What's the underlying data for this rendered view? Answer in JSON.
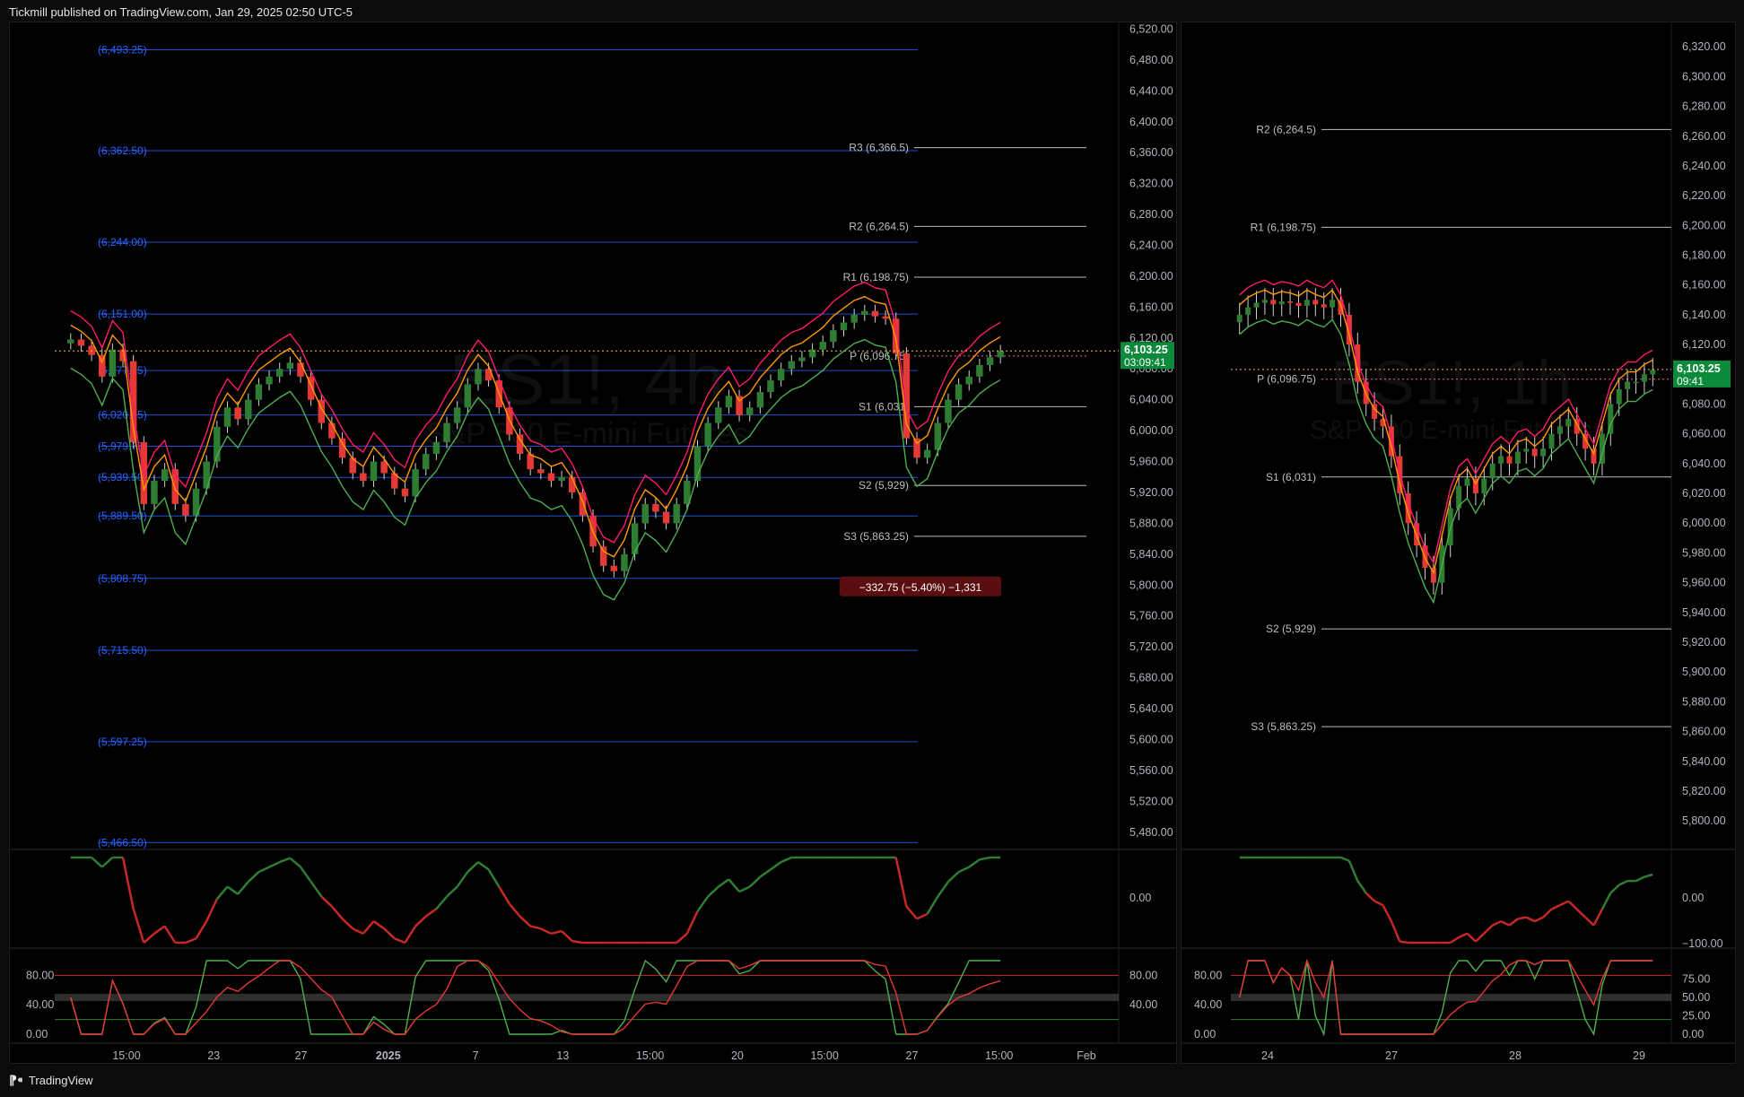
{
  "header": {
    "publisher": "Tickmill published on TradingView.com, Jan 29, 2025 02:50 UTC-5"
  },
  "footer": {
    "brand": "TradingView",
    "logo_icon": "tradingview-logo-icon"
  },
  "colors": {
    "up": "#2e7d32",
    "down": "#e53935",
    "pivot": "#bdbdbd",
    "fib": "#2962ff",
    "magenta": "#ff1a6b",
    "orange": "#ff9800",
    "green": "#4caf50",
    "price_badge": "#0a8a3a"
  },
  "chart_data": [
    {
      "type": "candlestick",
      "watermark": {
        "symbol": "ES1!, 4h",
        "name": "S&P 500 E-mini Futures"
      },
      "x_tick_labels": [
        "15:00",
        "23",
        "27",
        "2025",
        "7",
        "13",
        "15:00",
        "20",
        "15:00",
        "27",
        "15:00",
        "Feb"
      ],
      "y_tick_labels": [
        "6,520.00",
        "6,480.00",
        "6,440.00",
        "6,400.00",
        "6,360.00",
        "6,320.00",
        "6,280.00",
        "6,240.00",
        "6,200.00",
        "6,160.00",
        "6,120.00",
        "6,080.00",
        "6,040.00",
        "6,000.00",
        "5,960.00",
        "5,920.00",
        "5,880.00",
        "5,840.00",
        "5,800.00",
        "5,760.00",
        "5,720.00",
        "5,680.00",
        "5,640.00",
        "5,600.00",
        "5,560.00",
        "5,520.00",
        "5,480.00"
      ],
      "ylim": [
        5460,
        6524
      ],
      "fib_levels": [
        {
          "label": "(6,493.25)",
          "value": 6493.25
        },
        {
          "label": "(6,362.50)",
          "value": 6362.5
        },
        {
          "label": "(6,244.00)",
          "value": 6244
        },
        {
          "label": "(6,151.00)",
          "value": 6151
        },
        {
          "label": "(6,077.75)",
          "value": 6077.75
        },
        {
          "label": "(6,020.25)",
          "value": 6020.25
        },
        {
          "label": "(5,979.75)",
          "value": 5979.75
        },
        {
          "label": "(5,939.50)",
          "value": 5939.5
        },
        {
          "label": "(5,889.50)",
          "value": 5889.5
        },
        {
          "label": "(5,808.75)",
          "value": 5808.75
        },
        {
          "label": "(5,715.50)",
          "value": 5715.5
        },
        {
          "label": "(5,597.25)",
          "value": 5597.25
        },
        {
          "label": "(5,466.50)",
          "value": 5466.5
        }
      ],
      "pivots": [
        {
          "label": "R3 (6,366.5)",
          "value": 6366.5
        },
        {
          "label": "R2 (6,264.5)",
          "value": 6264.5
        },
        {
          "label": "R1 (6,198.75)",
          "value": 6198.75
        },
        {
          "label": "P (6,096.75)",
          "value": 6096.75
        },
        {
          "label": "S1 (6,031)",
          "value": 6031
        },
        {
          "label": "S2 (5,929)",
          "value": 5929
        },
        {
          "label": "S3 (5,863.25)",
          "value": 5863.25
        }
      ],
      "last_price": "6,103.25",
      "countdown": "03:09:41",
      "measure_label": "−332.75 (−5.40%) −1,331",
      "oscillator": {
        "y_tick_labels": [
          "0.00"
        ]
      },
      "stochastic": {
        "y_tick_labels": [
          "80.00",
          "40.00",
          "0.00"
        ],
        "right_labels": [
          "80.00",
          "40.00"
        ]
      },
      "close": [
        6118,
        6110,
        6098,
        6070,
        6105,
        6090,
        5985,
        5905,
        5935,
        5950,
        5905,
        5890,
        5925,
        5960,
        6005,
        6030,
        6015,
        6040,
        6060,
        6070,
        6080,
        6088,
        6070,
        6040,
        6010,
        5990,
        5965,
        5945,
        5935,
        5960,
        5945,
        5925,
        5915,
        5950,
        5970,
        5985,
        6010,
        6030,
        6060,
        6080,
        6065,
        6030,
        5995,
        5970,
        5950,
        5945,
        5935,
        5940,
        5920,
        5890,
        5850,
        5825,
        5818,
        5840,
        5880,
        5905,
        5895,
        5880,
        5905,
        5935,
        5980,
        6010,
        6030,
        6045,
        6020,
        6030,
        6050,
        6065,
        6080,
        6090,
        6095,
        6105,
        6115,
        6130,
        6140,
        6150,
        6155,
        6148,
        6145,
        6100,
        5990,
        5965,
        5975,
        6010,
        6040,
        6060,
        6070,
        6085,
        6095,
        6103
      ]
    },
    {
      "type": "candlestick",
      "watermark": {
        "symbol": "ES1!, 1h",
        "name": "S&P 500 E-mini Futures"
      },
      "x_tick_labels": [
        "24",
        "27",
        "28",
        "29"
      ],
      "y_tick_labels": [
        "6,320.00",
        "6,300.00",
        "6,280.00",
        "6,260.00",
        "6,240.00",
        "6,220.00",
        "6,200.00",
        "6,180.00",
        "6,160.00",
        "6,140.00",
        "6,120.00",
        "6,100.00",
        "6,080.00",
        "6,060.00",
        "6,040.00",
        "6,020.00",
        "6,000.00",
        "5,980.00",
        "5,960.00",
        "5,940.00",
        "5,920.00",
        "5,900.00",
        "5,880.00",
        "5,860.00",
        "5,840.00",
        "5,820.00",
        "5,800.00"
      ],
      "ylim": [
        5782,
        6334
      ],
      "pivots": [
        {
          "label": "R2 (6,264.5)",
          "value": 6264.5
        },
        {
          "label": "R1 (6,198.75)",
          "value": 6198.75
        },
        {
          "label": "P (6,096.75)",
          "value": 6096.75
        },
        {
          "label": "S1 (6,031)",
          "value": 6031
        },
        {
          "label": "S2 (5,929)",
          "value": 5929
        },
        {
          "label": "S3 (5,863.25)",
          "value": 5863.25
        }
      ],
      "last_price": "6,103.25",
      "countdown": "09:41",
      "oscillator": {
        "y_tick_labels": [
          "0.00",
          "−100.00"
        ]
      },
      "stochastic": {
        "y_tick_labels": [
          "80.00",
          "40.00",
          "0.00"
        ],
        "right_labels": [
          "75.00",
          "50.00",
          "25.00",
          "0.00"
        ]
      },
      "close": [
        6140,
        6145,
        6148,
        6150,
        6147,
        6149,
        6148,
        6146,
        6150,
        6147,
        6145,
        6150,
        6140,
        6120,
        6095,
        6080,
        6070,
        6065,
        6045,
        6020,
        6000,
        5985,
        5970,
        5960,
        5985,
        6010,
        6025,
        6030,
        6020,
        6030,
        6040,
        6045,
        6040,
        6048,
        6050,
        6045,
        6050,
        6060,
        6065,
        6070,
        6060,
        6050,
        6040,
        6060,
        6080,
        6090,
        6095,
        6095,
        6100,
        6103
      ]
    }
  ]
}
